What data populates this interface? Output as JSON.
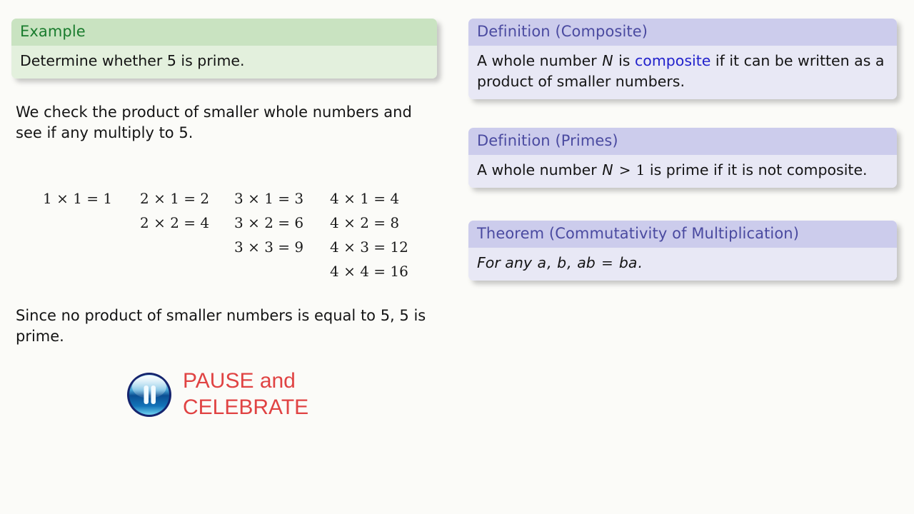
{
  "slide": {
    "background_color": "#fbfbf8",
    "example_block": {
      "title": "Example",
      "statement": "Determine whether 5 is prime.",
      "title_color": "#1a7c2e",
      "header_bg": "#c9e3c1",
      "body_bg": "#e3f0dd"
    },
    "explanation": "We check the product of smaller whole numbers and see if any multiply to 5.",
    "conclusion": "Since no product of smaller numbers is equal to 5, 5 is prime.",
    "multiplication_table": {
      "columns": [
        [
          "1 × 1 = 1"
        ],
        [
          "2 × 1 = 2",
          "2 × 2 = 4"
        ],
        [
          "3 × 1 = 3",
          "3 × 2 = 6",
          "3 × 3 = 9"
        ],
        [
          "4 × 1 = 4",
          "4 × 2 = 8",
          "4 × 3 = 12",
          "4 × 4 = 16"
        ]
      ],
      "rows": [
        [
          "1 × 1 = 1",
          "2 × 1 = 2",
          "3 × 1 = 3",
          "4 × 1 = 4"
        ],
        [
          "",
          "2 × 2 = 4",
          "3 × 2 = 6",
          "4 × 2 = 8"
        ],
        [
          "",
          "",
          "3 × 3 = 9",
          "4 × 3 = 12"
        ],
        [
          "",
          "",
          "",
          "4 × 4 = 16"
        ]
      ]
    },
    "pause_callout": {
      "icon": "pause-button-icon",
      "line1": "PAUSE and",
      "line2": "CELEBRATE",
      "text_color": "#e04343"
    },
    "blocks": [
      {
        "title": "Definition (Composite)",
        "body_parts": [
          {
            "text": "A whole number ",
            "style": "plain"
          },
          {
            "text": "N",
            "style": "math-italic"
          },
          {
            "text": " is ",
            "style": "plain"
          },
          {
            "text": "composite",
            "style": "highlight"
          },
          {
            "text": " if it can be written as a product of smaller numbers.",
            "style": "plain"
          }
        ],
        "header_bg": "#ccccec",
        "body_bg": "#e8e8f5",
        "title_color": "#4a4aa0"
      },
      {
        "title": "Definition (Primes)",
        "body_parts": [
          {
            "text": "A whole number ",
            "style": "plain"
          },
          {
            "text": "N",
            "style": "math-italic"
          },
          {
            "text": " > ",
            "style": "math-rel"
          },
          {
            "text": "1",
            "style": "math-plain"
          },
          {
            "text": " is prime if it is not composite.",
            "style": "plain"
          }
        ],
        "header_bg": "#ccccec",
        "body_bg": "#e8e8f5",
        "title_color": "#4a4aa0"
      },
      {
        "title": "Theorem (Commutativity of Multiplication)",
        "body_parts": [
          {
            "text": "For any ",
            "style": "italic"
          },
          {
            "text": "a",
            "style": "math-italic"
          },
          {
            "text": ", ",
            "style": "italic"
          },
          {
            "text": "b",
            "style": "math-italic"
          },
          {
            "text": ", ",
            "style": "italic"
          },
          {
            "text": "ab",
            "style": "math-italic"
          },
          {
            "text": " = ",
            "style": "math-rel"
          },
          {
            "text": "ba",
            "style": "math-italic"
          },
          {
            "text": ".",
            "style": "italic"
          }
        ],
        "header_bg": "#ccccec",
        "body_bg": "#e8e8f5",
        "title_color": "#4a4aa0"
      }
    ]
  }
}
